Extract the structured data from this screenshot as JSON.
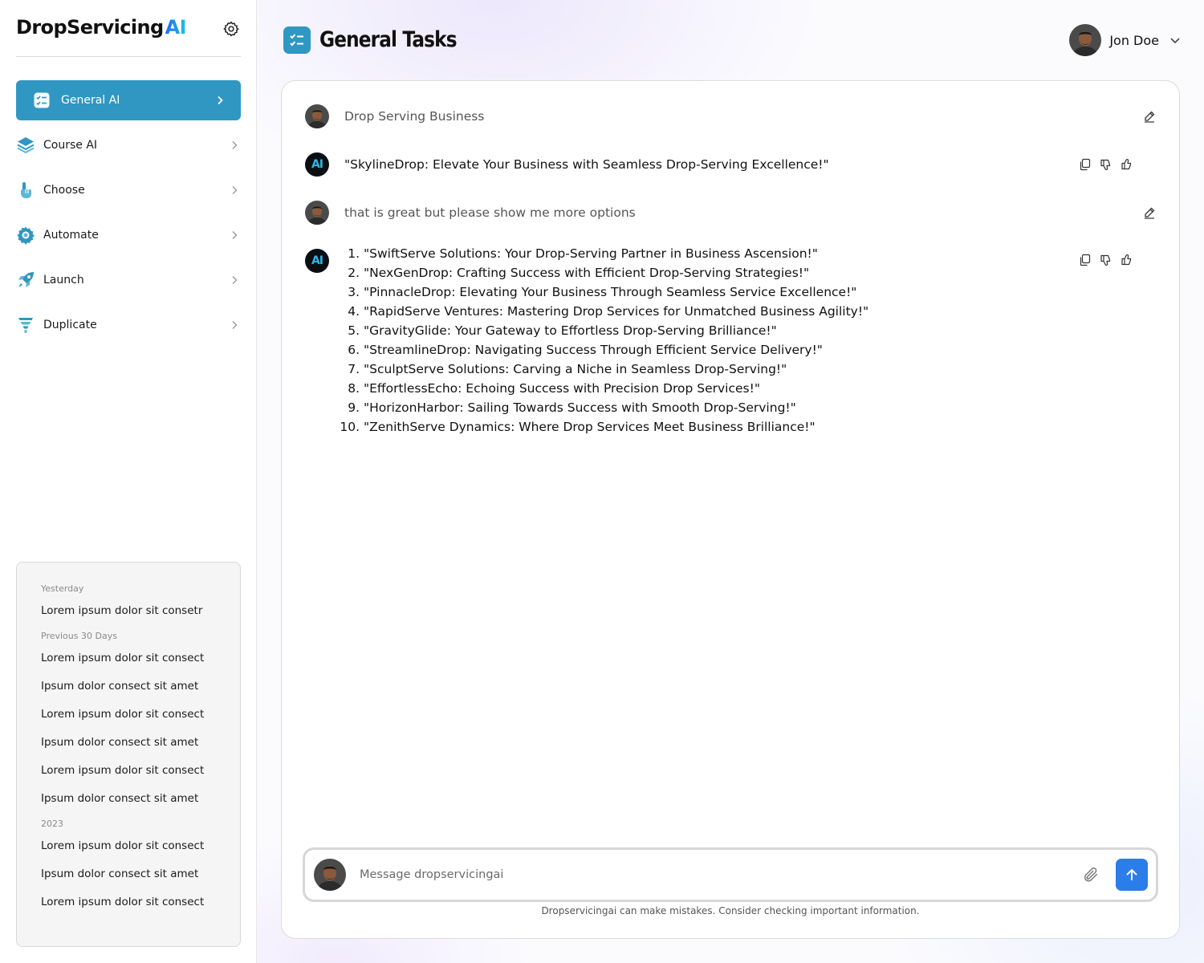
{
  "brand": {
    "name": "DropServicing",
    "suffix": "AI"
  },
  "nav": {
    "items": [
      {
        "label": "General AI",
        "icon": "checklist-icon",
        "active": true
      },
      {
        "label": "Course AI",
        "icon": "layers-icon",
        "active": false
      },
      {
        "label": "Choose",
        "icon": "pointer-hand-icon",
        "active": false
      },
      {
        "label": "Automate",
        "icon": "gear-cycle-icon",
        "active": false
      },
      {
        "label": "Launch",
        "icon": "rocket-icon",
        "active": false
      },
      {
        "label": "Duplicate",
        "icon": "funnel-icon",
        "active": false
      }
    ]
  },
  "history": {
    "groups": [
      {
        "label": "Yesterday",
        "items": [
          "Lorem ipsum dolor sit consetr"
        ]
      },
      {
        "label": "Previous 30 Days",
        "items": [
          "Lorem ipsum dolor sit consect",
          "Ipsum dolor consect sit amet",
          "Lorem ipsum dolor sit consect",
          "Ipsum dolor consect sit amet",
          "Lorem ipsum dolor sit consect",
          "Ipsum dolor consect sit amet"
        ]
      },
      {
        "label": "2023",
        "items": [
          "Lorem ipsum dolor sit consect",
          "Ipsum dolor consect sit amet",
          "Lorem ipsum dolor sit consect"
        ]
      }
    ]
  },
  "header": {
    "title": "General Tasks",
    "user_name": "Jon Doe"
  },
  "chat": {
    "messages": [
      {
        "role": "user",
        "text": "Drop Serving Business"
      },
      {
        "role": "ai",
        "text": "\"SkylineDrop: Elevate Your Business with Seamless Drop-Serving Excellence!\""
      },
      {
        "role": "user",
        "text": "that is great but please show me more options"
      }
    ],
    "ai_avatar_label": "AI",
    "options": [
      "\"SwiftServe Solutions: Your Drop-Serving Partner in Business Ascension!\"",
      "\"NexGenDrop: Crafting Success with Efficient Drop-Serving Strategies!\"",
      "\"PinnacleDrop: Elevating Your Business Through Seamless Service Excellence!\"",
      "\"RapidServe Ventures: Mastering Drop Services for Unmatched Business Agility!\"",
      "\"GravityGlide: Your Gateway to Effortless Drop-Serving Brilliance!\"",
      "\"StreamlineDrop: Navigating Success Through Efficient Service Delivery!\"",
      "\"SculptServe Solutions: Carving a Niche in Seamless Drop-Serving!\"",
      "\"EffortlessEcho: Echoing Success with Precision Drop Services!\"",
      "\"HorizonHarbor: Sailing Towards Success with Smooth Drop-Serving!\"",
      "\"ZenithServe Dynamics: Where Drop Services Meet Business Brilliance!\""
    ]
  },
  "composer": {
    "placeholder": "Message dropservicingai",
    "value": "",
    "disclaimer": "Dropservicingai can make mistakes. Consider checking important information."
  },
  "colors": {
    "accent": "#2f97c1",
    "send": "#2b7de9"
  }
}
